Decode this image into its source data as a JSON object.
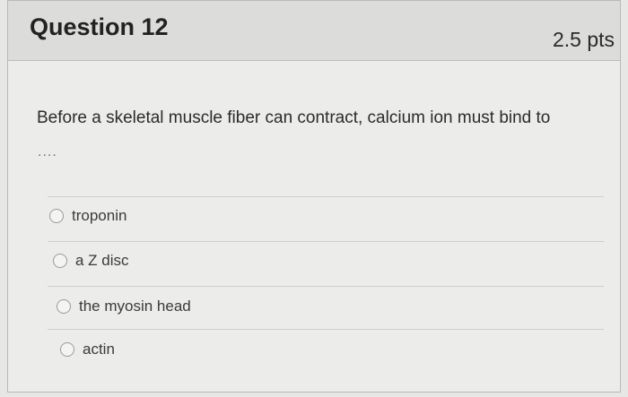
{
  "question": {
    "title": "Question 12",
    "points": "2.5 pts",
    "text": "Before a skeletal muscle fiber can contract, calcium ion must bind to",
    "continuation": "...."
  },
  "options": [
    {
      "label": "troponin"
    },
    {
      "label": "a Z disc"
    },
    {
      "label": "the myosin head"
    },
    {
      "label": "actin"
    }
  ]
}
